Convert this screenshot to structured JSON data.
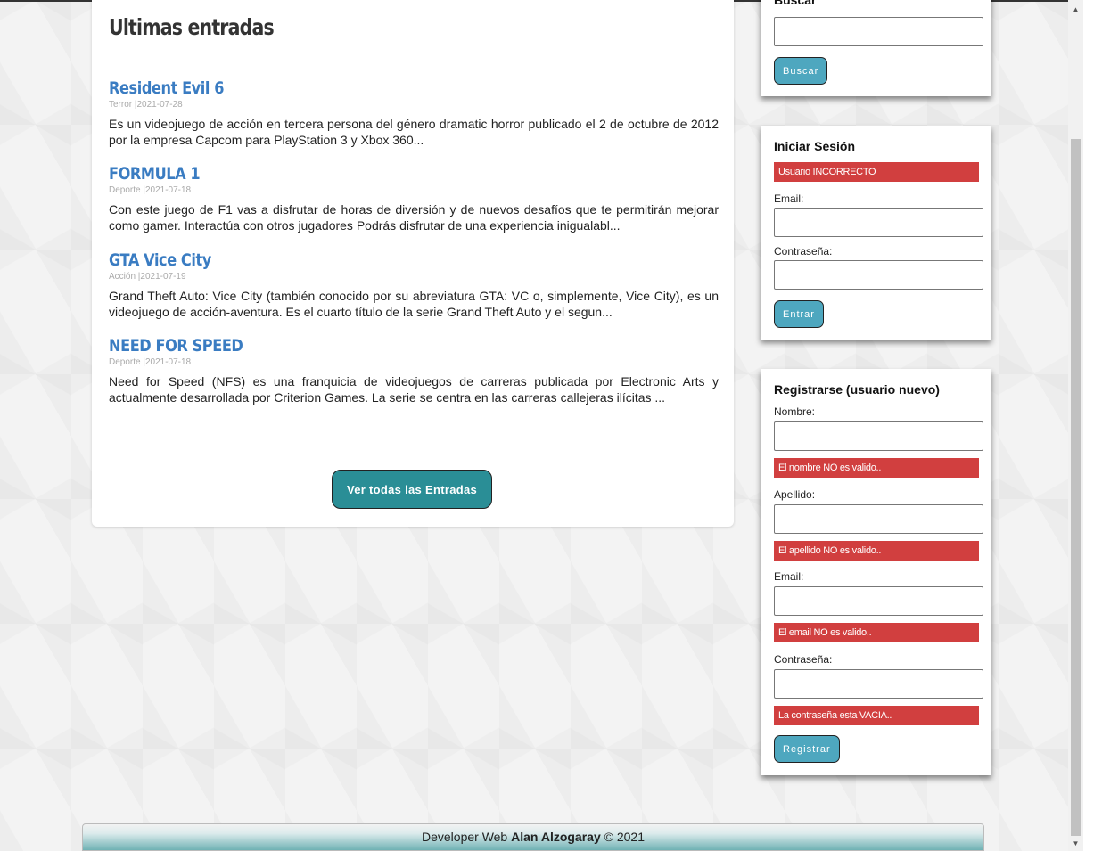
{
  "main": {
    "title": "Ultimas entradas",
    "posts": [
      {
        "title": "Resident Evil 6",
        "category": "Terror",
        "date": "2021-07-28",
        "meta": "Terror |2021-07-28",
        "excerpt": "Es un videojuego de acción en tercera persona del género dramatic horror publicado el 2 de octubre de 2012 por la empresa Capcom para PlayStation 3 y Xbox 360..."
      },
      {
        "title": "FORMULA 1",
        "category": "Deporte",
        "date": "2021-07-18",
        "meta": "Deporte |2021-07-18",
        "excerpt": "Con este juego de F1 vas a disfrutar de horas de diversión y de nuevos desafíos que te permitirán mejorar como gamer. Interactúa con otros jugadores Podrás disfrutar de una experiencia inigualabl..."
      },
      {
        "title": "GTA Vice City",
        "category": "Acción",
        "date": "2021-07-19",
        "meta": "Acción |2021-07-19",
        "excerpt": "Grand Theft Auto: Vice City (también conocido por su abreviatura GTA: VC o, simplemente, Vice City), es un videojuego de acción-aventura. Es el cuarto título de la serie Grand Theft Auto y el segun..."
      },
      {
        "title": "NEED FOR SPEED",
        "category": "Deporte",
        "date": "2021-07-18",
        "meta": "Deporte |2021-07-18",
        "excerpt": "Need for Speed (NFS) es una franquicia de videojuegos de carreras publicada por Electronic Arts y actualmente desarrollada por Criterion Games. La serie se centra en las carreras callejeras ilícitas ..."
      }
    ],
    "all_button": "Ver todas las Entradas"
  },
  "search": {
    "title": "Buscar",
    "button": "Buscar",
    "value": ""
  },
  "login": {
    "title": "Iniciar Sesión",
    "error": "Usuario INCORRECTO",
    "email_label": "Email:",
    "password_label": "Contraseña:",
    "button": "Entrar"
  },
  "register": {
    "title": "Registrarse (usuario nuevo)",
    "name_label": "Nombre:",
    "name_error": "El nombre NO es valido..",
    "surname_label": "Apellido:",
    "surname_error": "El apellido NO es valido..",
    "email_label": "Email:",
    "email_error": "El email NO es valido..",
    "password_label": "Contraseña:",
    "password_error": "La contraseña esta VACIA..",
    "button": "Registrar"
  },
  "footer": {
    "prefix": "Developer Web",
    "author": "Alan Alzogaray",
    "suffix": "© 2021"
  },
  "colors": {
    "post_title": "#3a7cc2",
    "alert": "#d13f3f",
    "primary_button": "#2a8e96",
    "secondary_button": "#4ea7bf"
  },
  "icons": {
    "scroll_up": "▲",
    "scroll_down": "▼"
  }
}
